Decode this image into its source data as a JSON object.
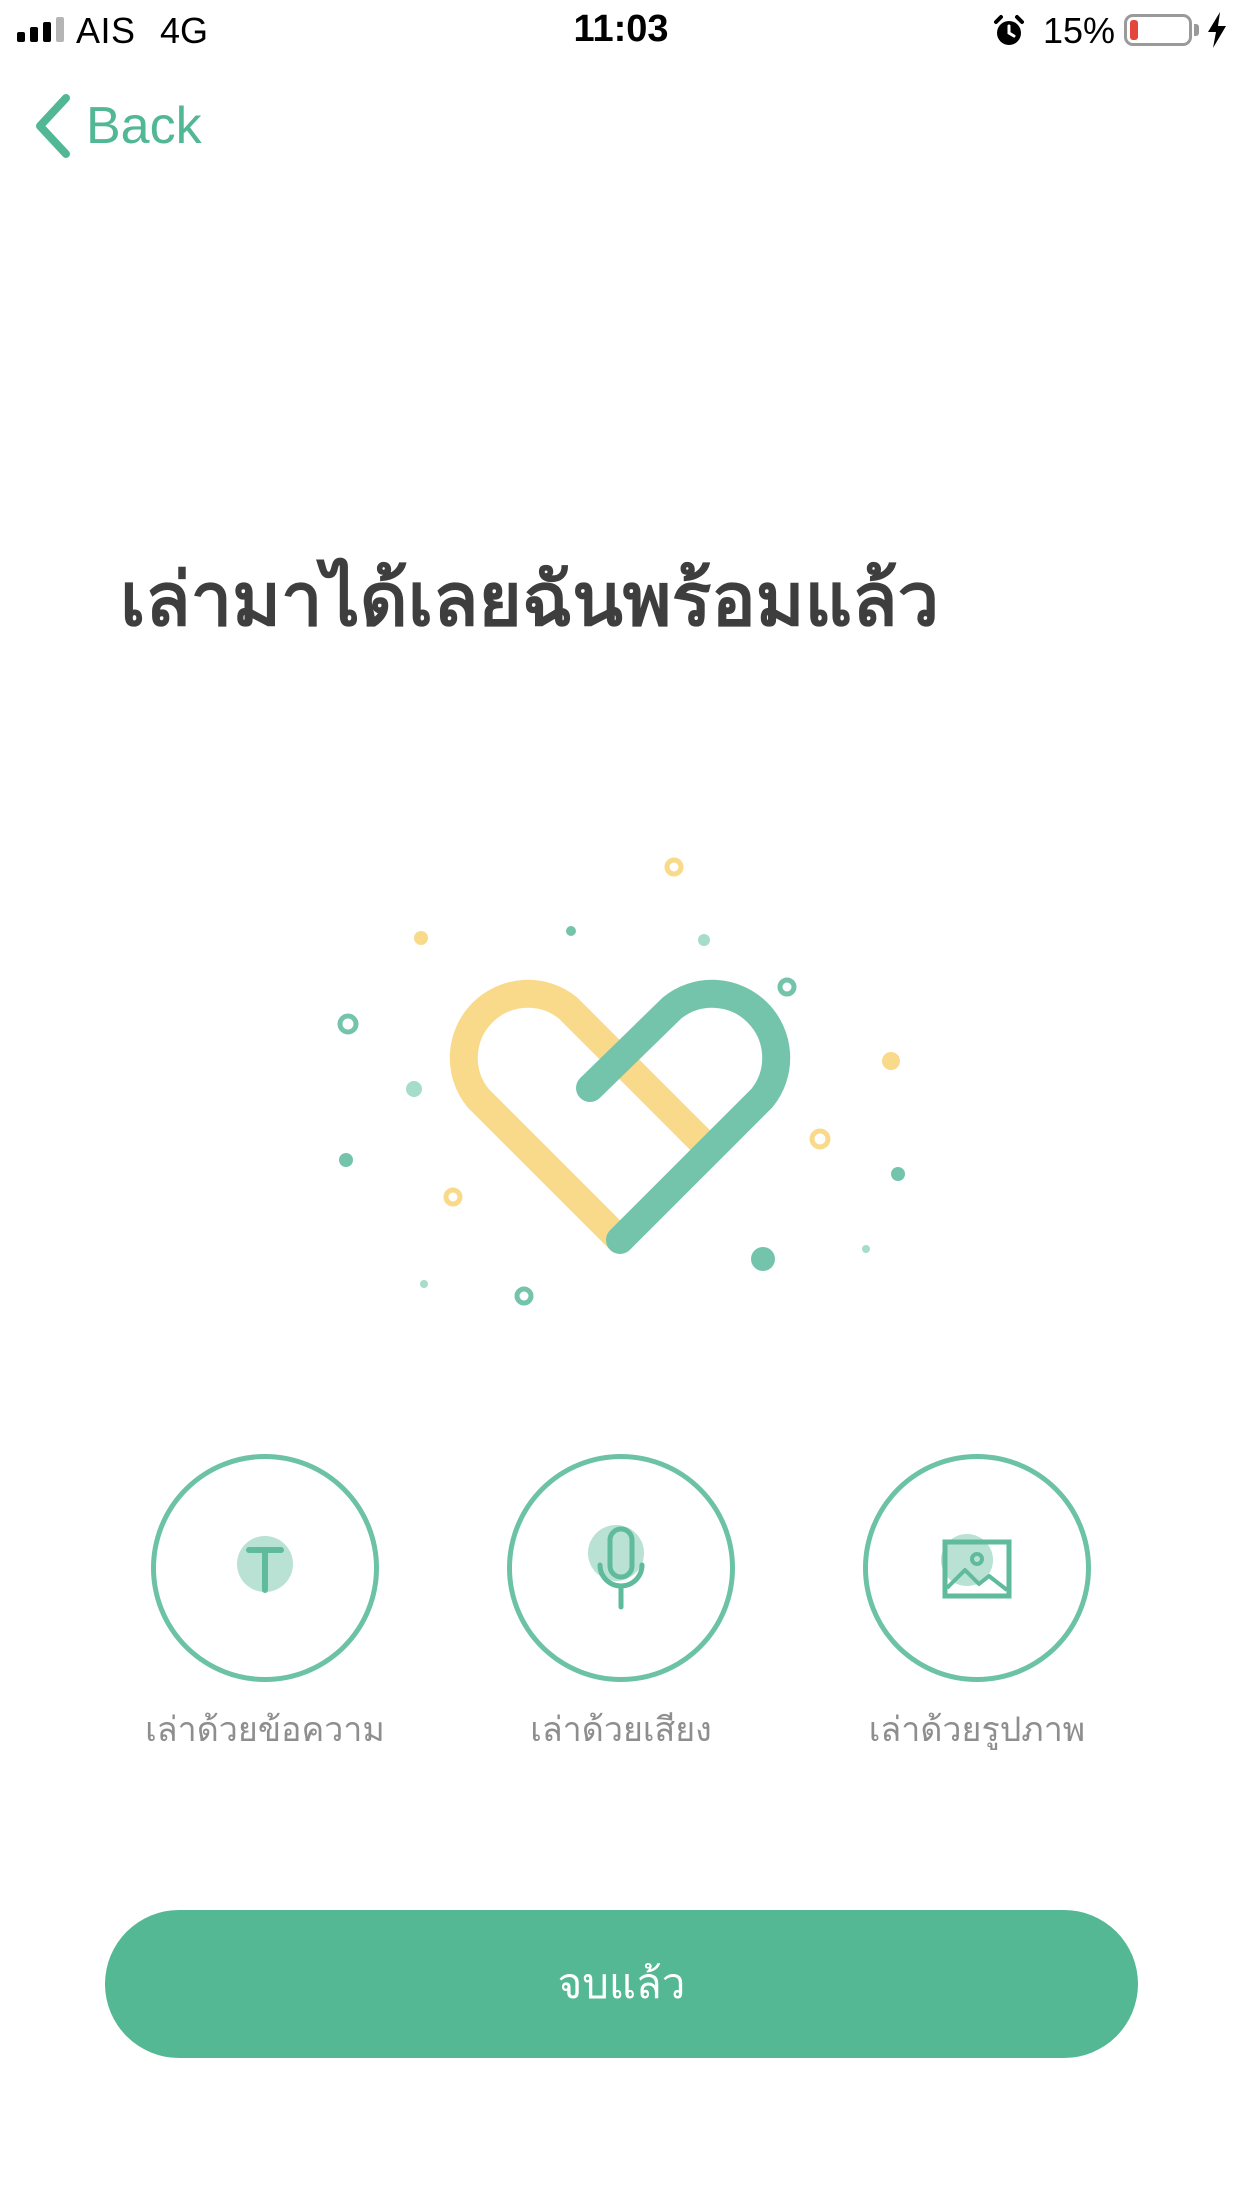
{
  "status_bar": {
    "carrier": "AIS",
    "network": "4G",
    "time": "11:03",
    "battery_percent_text": "15%",
    "battery_level": 0.15,
    "battery_color": "#e5463c",
    "icons": [
      "signal-icon",
      "alarm-icon",
      "battery-icon",
      "charging-bolt-icon"
    ]
  },
  "nav": {
    "back_label": "Back",
    "accent_color": "#52b794"
  },
  "title": "เล่ามาได้เลยฉันพร้อมแล้ว",
  "illustration": {
    "icon": "heart-icon",
    "colors": [
      "#f8da8a",
      "#74c4ab"
    ]
  },
  "options": [
    {
      "label": "เล่าด้วยข้อความ",
      "icon": "text-icon"
    },
    {
      "label": "เล่าด้วยเสียง",
      "icon": "microphone-icon"
    },
    {
      "label": "เล่าด้วยรูปภาพ",
      "icon": "image-icon"
    }
  ],
  "finish_button": {
    "label": "จบแล้ว",
    "color": "#54b894"
  }
}
